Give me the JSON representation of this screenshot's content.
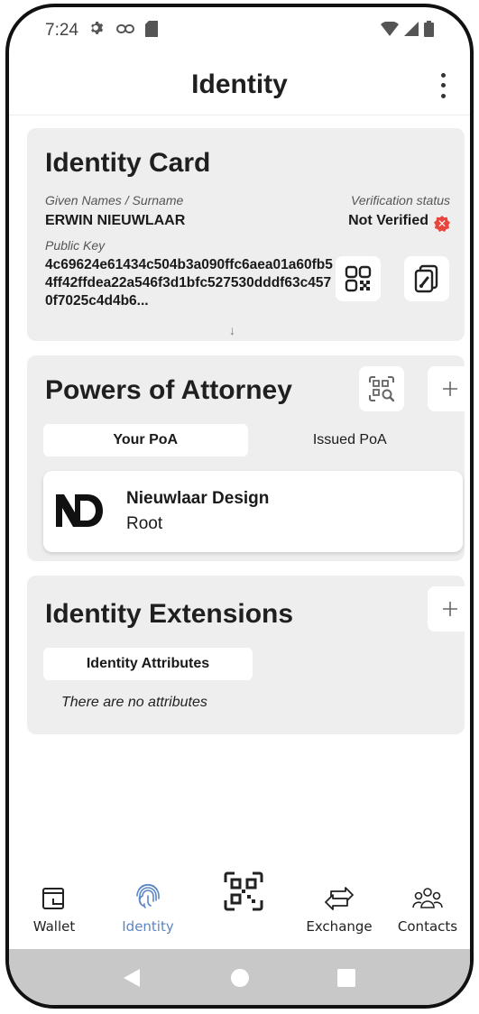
{
  "status_bar": {
    "time": "7:24",
    "icons": [
      "gear-icon",
      "link-icon",
      "sd-card-icon",
      "wifi-icon",
      "signal-icon",
      "battery-icon"
    ]
  },
  "app_bar": {
    "title": "Identity",
    "menu_icon": "more-vert-icon"
  },
  "identity_card": {
    "title": "Identity Card",
    "names_label": "Given Names / Surname",
    "names_value": "ERWIN NIEUWLAAR",
    "verification_label": "Verification status",
    "verification_value": "Not Verified",
    "verification_badge_color": "#e8453c",
    "public_key_label": "Public Key",
    "public_key_value": "4c69624e61434c504b3a090ffc6aea01a60fb54ff42ffdea22a546f3d1bfc527530dddf63c4570f7025c4d4b6...",
    "expand_icon": "arrow-down-icon",
    "qr_button_icon": "qr-code-icon",
    "sign_button_icon": "document-sign-icon"
  },
  "poa_card": {
    "title": "Powers of Attorney",
    "scan_icon": "qr-scan-search-icon",
    "add_icon": "plus-icon",
    "tabs": [
      {
        "label": "Your PoA",
        "active": true
      },
      {
        "label": "Issued PoA",
        "active": false
      }
    ],
    "items": [
      {
        "logo": "ND",
        "name": "Nieuwlaar Design",
        "role": "Root"
      }
    ]
  },
  "extensions_card": {
    "title": "Identity Extensions",
    "add_icon": "plus-icon",
    "tab_label": "Identity Attributes",
    "empty_text": "There are no attributes"
  },
  "bottom_nav": {
    "active_color": "#5b86c5",
    "items": [
      {
        "label": "Wallet",
        "icon": "wallet-icon",
        "active": false
      },
      {
        "label": "Identity",
        "icon": "fingerprint-icon",
        "active": true
      },
      {
        "label": "",
        "icon": "qr-scan-icon",
        "active": false
      },
      {
        "label": "Exchange",
        "icon": "exchange-icon",
        "active": false
      },
      {
        "label": "Contacts",
        "icon": "contacts-icon",
        "active": false
      }
    ]
  },
  "system_nav": {
    "icons": [
      "back-icon",
      "home-icon",
      "recents-icon"
    ]
  }
}
